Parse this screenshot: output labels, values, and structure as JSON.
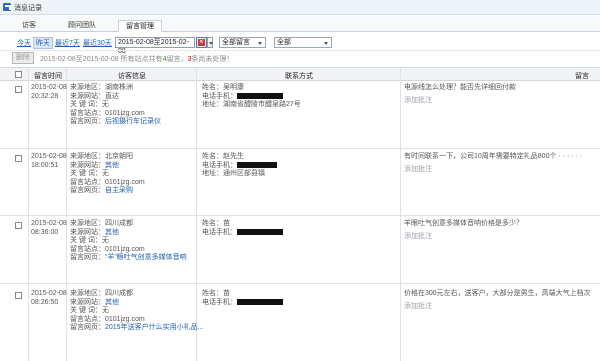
{
  "window": {
    "title": "消息记录"
  },
  "tabs": [
    {
      "label": "访客",
      "active": false
    },
    {
      "label": "顾问团队",
      "active": false
    },
    {
      "label": "留言管理",
      "active": true
    }
  ],
  "filter": {
    "quick_links": [
      {
        "label": "今天",
        "active": false
      },
      {
        "label": "昨天",
        "active": true
      },
      {
        "label": "最近7天",
        "active": false
      },
      {
        "label": "最近30天",
        "active": false
      }
    ],
    "date_range": "2015-02-08至2015-02-08",
    "type_select": "全部留言",
    "status_select": "全部"
  },
  "actions": {
    "delete_label": "删除",
    "status_prefix": "2015-02-08至2015-02-08  所有站点共有",
    "total_count": "4",
    "status_mid": "留言，",
    "unprocessed_count": "3",
    "status_suffix": "条尚未处理！"
  },
  "table": {
    "headers": [
      "留言时间",
      "访客信息",
      "联系方式",
      "留言"
    ],
    "rows": [
      {
        "date": "2015-02-08",
        "time": "20:32:28",
        "region": "来源地区：湖南株洲",
        "site_label": "来源网站：",
        "site": "直达",
        "keyword": "关 键 词：无",
        "station": "留言站点：0101jzg.com",
        "page_label": "留言网页：",
        "page": "后视摄行车记录仪",
        "name": "姓名：吴明康",
        "phone_label": "电话手机：",
        "address": "地址：湖南省醴陵市醴泉路27号",
        "message": "电源线怎么处理？能否先详细回付款",
        "note": "添加批注"
      },
      {
        "date": "2015-02-08",
        "time": "18:00:51",
        "region": "来源地区：北京朝阳",
        "site_label": "来源网站：",
        "site": "其他",
        "keyword": "关 键 词：无",
        "station": "留言站点：0101jzg.com",
        "page_label": "留言网页：",
        "page": "自主采购",
        "name": "姓名：赵先生",
        "phone_label": "电话手机：",
        "address": "地址：通州区部县镇",
        "message": "有时间联系一下，公司10周年需要特定礼品800个 · · · · · ·",
        "note": "添加批注"
      },
      {
        "date": "2015-02-08",
        "time": "08:36:00",
        "region": "来源地区：四川成都",
        "site_label": "来源网站：",
        "site": "其他",
        "keyword": "关 键 词：无",
        "station": "留言站点：0101jzg.com",
        "page_label": "留言网页：",
        "page": "“羊”眼吐气创意多媒体音响",
        "name": "姓名：苗",
        "phone_label": "电话手机：",
        "address": "",
        "message": "羊眼吐气创意多媒体音响价格是多少？",
        "note": "添加批注"
      },
      {
        "date": "2015-02-08",
        "time": "08:26:50",
        "region": "来源地区：四川成都",
        "site_label": "来源网站：",
        "site": "其他",
        "keyword": "关 键 词：无",
        "station": "留言站点：0101jzg.com",
        "page_label": "留言网页：",
        "page": "2015年送客户什么实用小礼品...",
        "name": "姓名：苗",
        "phone_label": "电话手机：",
        "address": "",
        "message": "价格在300元左右，送客户，大部分是男生，高端大气上档次",
        "note": "添加批注"
      }
    ]
  }
}
